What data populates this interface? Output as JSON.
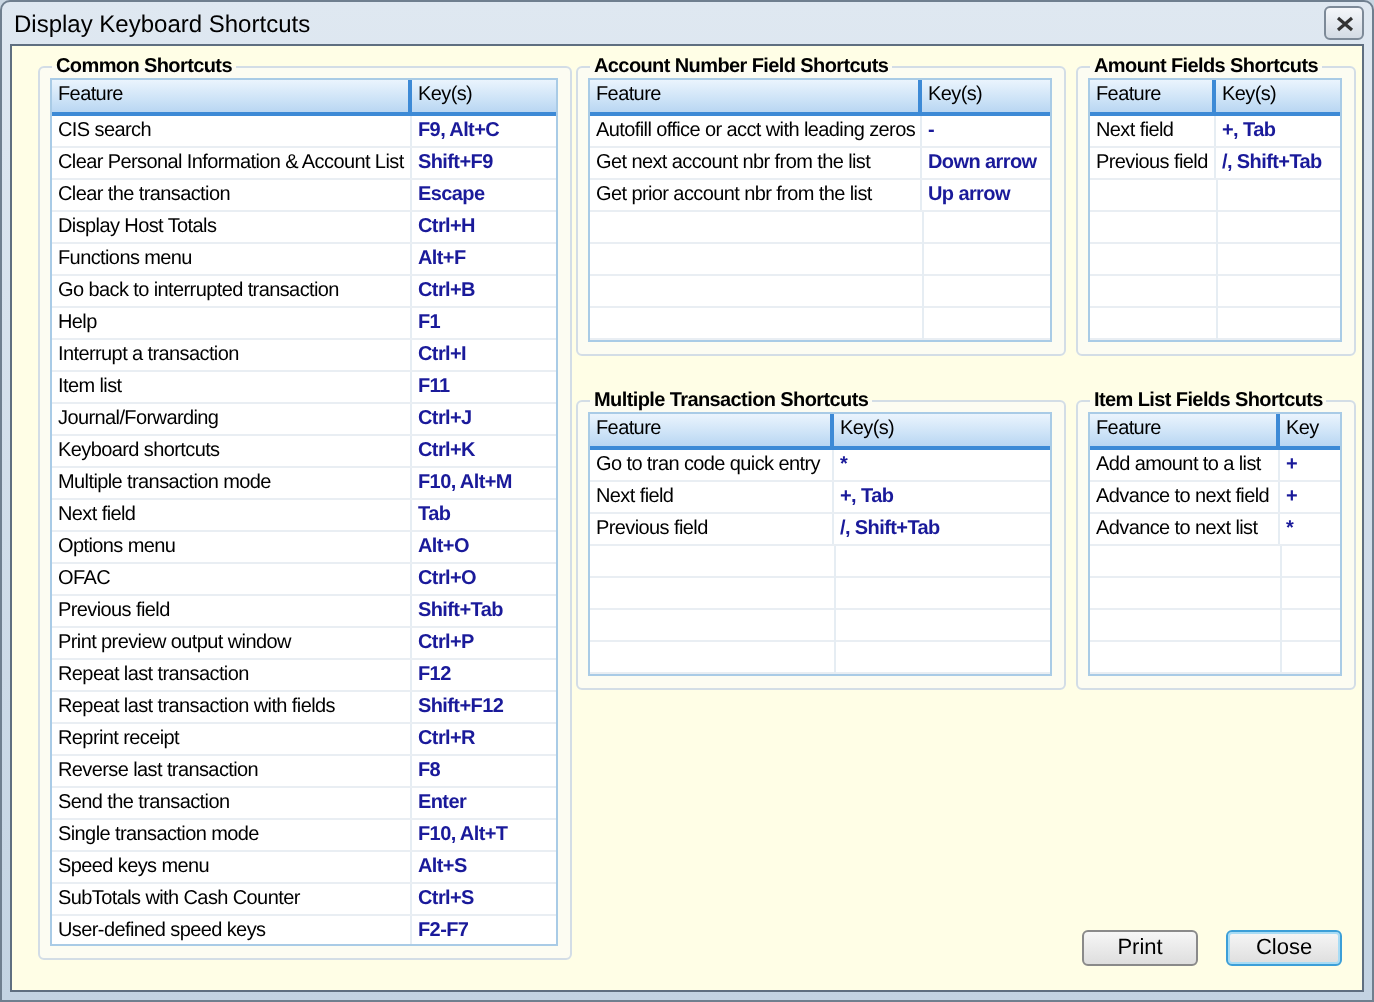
{
  "window": {
    "title": "Display Keyboard Shortcuts"
  },
  "panels": [
    {
      "title": "Common Shortcuts",
      "columns": [
        "Feature",
        "Key(s)"
      ],
      "rows": [
        {
          "feature": "CIS search",
          "keys": "F9, Alt+C"
        },
        {
          "feature": "Clear Personal Information & Account List",
          "keys": "Shift+F9"
        },
        {
          "feature": "Clear the transaction",
          "keys": "Escape"
        },
        {
          "feature": "Display Host Totals",
          "keys": "Ctrl+H"
        },
        {
          "feature": "Functions menu",
          "keys": "Alt+F"
        },
        {
          "feature": "Go back to interrupted transaction",
          "keys": "Ctrl+B"
        },
        {
          "feature": "Help",
          "keys": "F1"
        },
        {
          "feature": "Interrupt a transaction",
          "keys": "Ctrl+I"
        },
        {
          "feature": "Item list",
          "keys": "F11"
        },
        {
          "feature": "Journal/Forwarding",
          "keys": "Ctrl+J"
        },
        {
          "feature": "Keyboard shortcuts",
          "keys": "Ctrl+K"
        },
        {
          "feature": "Multiple transaction mode",
          "keys": "F10, Alt+M"
        },
        {
          "feature": "Next field",
          "keys": "Tab"
        },
        {
          "feature": "Options menu",
          "keys": "Alt+O"
        },
        {
          "feature": "OFAC",
          "keys": "Ctrl+O"
        },
        {
          "feature": "Previous field",
          "keys": "Shift+Tab"
        },
        {
          "feature": "Print preview output window",
          "keys": "Ctrl+P"
        },
        {
          "feature": "Repeat last transaction",
          "keys": "F12"
        },
        {
          "feature": "Repeat last transaction with fields",
          "keys": "Shift+F12"
        },
        {
          "feature": "Reprint receipt",
          "keys": "Ctrl+R"
        },
        {
          "feature": "Reverse last transaction",
          "keys": "F8"
        },
        {
          "feature": "Send the transaction",
          "keys": "Enter"
        },
        {
          "feature": "Single transaction mode",
          "keys": "F10, Alt+T"
        },
        {
          "feature": "Speed keys menu",
          "keys": "Alt+S"
        },
        {
          "feature": "SubTotals with Cash Counter",
          "keys": "Ctrl+S"
        },
        {
          "feature": "User-defined speed keys",
          "keys": "F2-F7"
        }
      ]
    },
    {
      "title": "Account Number Field Shortcuts",
      "columns": [
        "Feature",
        "Key(s)"
      ],
      "rows": [
        {
          "feature": "Autofill office or acct with leading zeros",
          "keys": "-"
        },
        {
          "feature": "Get next account nbr from the list",
          "keys": "Down arrow"
        },
        {
          "feature": "Get prior account nbr from the list",
          "keys": "Up arrow"
        }
      ]
    },
    {
      "title": "Amount Fields Shortcuts",
      "columns": [
        "Feature",
        "Key(s)"
      ],
      "rows": [
        {
          "feature": "Next field",
          "keys": "+, Tab"
        },
        {
          "feature": "Previous field",
          "keys": "/, Shift+Tab"
        }
      ]
    },
    {
      "title": "Multiple Transaction Shortcuts",
      "columns": [
        "Feature",
        "Key(s)"
      ],
      "rows": [
        {
          "feature": "Go to tran code quick entry",
          "keys": "*"
        },
        {
          "feature": "Next field",
          "keys": "+, Tab"
        },
        {
          "feature": "Previous field",
          "keys": "/, Shift+Tab"
        }
      ]
    },
    {
      "title": "Item List Fields Shortcuts",
      "columns": [
        "Feature",
        "Key"
      ],
      "rows": [
        {
          "feature": "Add amount to a list",
          "keys": "+"
        },
        {
          "feature": "Advance to next field",
          "keys": "+"
        },
        {
          "feature": "Advance to next list",
          "keys": "*"
        }
      ]
    }
  ],
  "buttons": [
    {
      "label": "Print",
      "default": false
    },
    {
      "label": "Close",
      "default": true
    }
  ]
}
